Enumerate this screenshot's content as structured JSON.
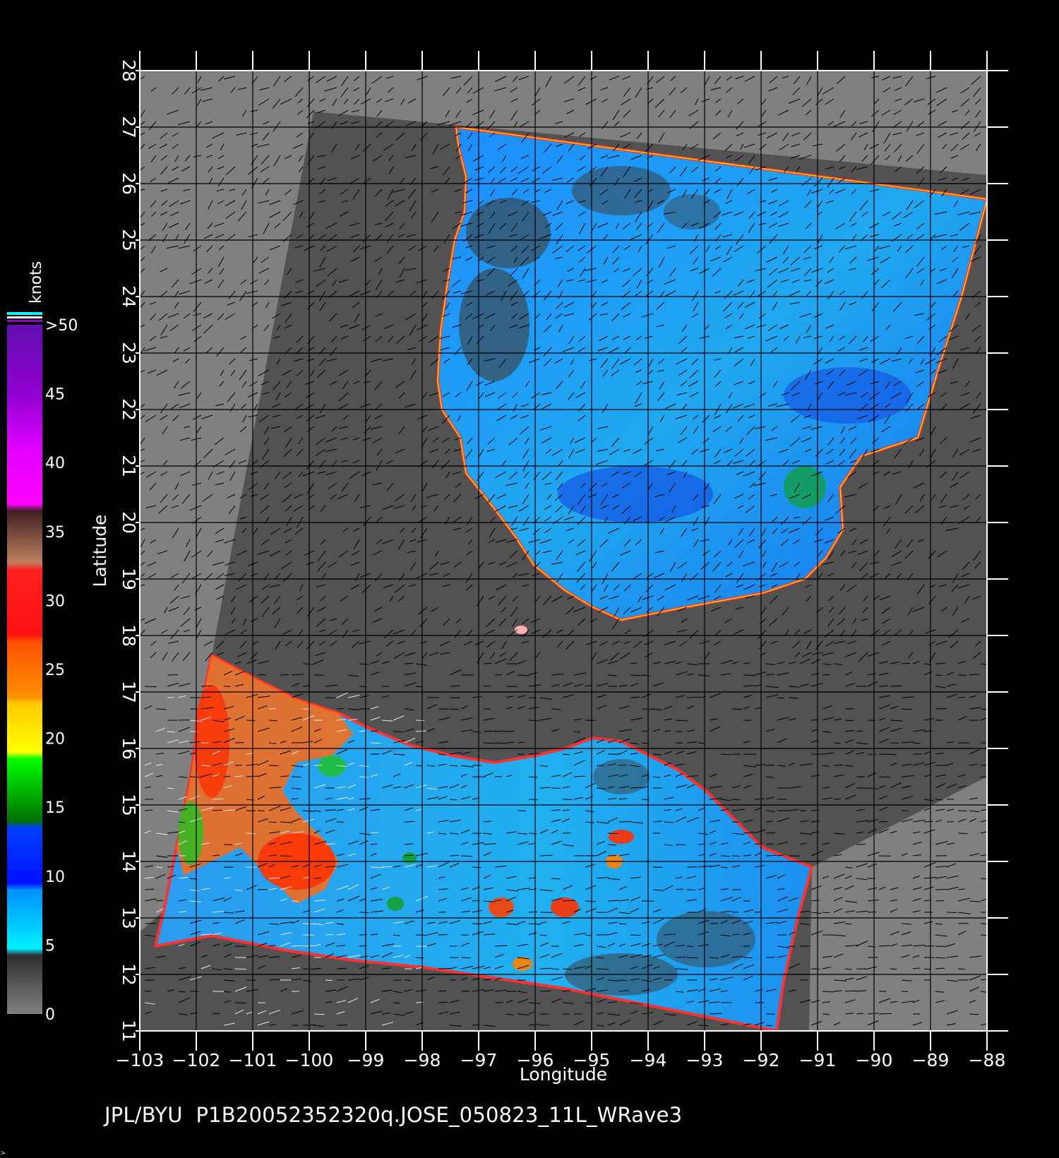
{
  "map": {
    "xlabel": "Longitude",
    "ylabel": "Latitude",
    "lon_range": [
      -103,
      -88
    ],
    "lat_range": [
      11,
      28
    ],
    "lon_ticks": [
      "−103",
      "−102",
      "−101",
      "−100",
      "−99",
      "−98",
      "−97",
      "−96",
      "−95",
      "−94",
      "−93",
      "−92",
      "−91",
      "−90",
      "−89",
      "−88"
    ],
    "lat_ticks": [
      "11",
      "12",
      "13",
      "14",
      "15",
      "16",
      "17",
      "18",
      "19",
      "20",
      "21",
      "22",
      "23",
      "24",
      "25",
      "26",
      "27",
      "28"
    ],
    "grid": true,
    "background_color": "#808080",
    "swath_color": "#505050"
  },
  "colorbar": {
    "unit": "knots",
    "labels": [
      "0",
      "5",
      "10",
      "15",
      "20",
      "25",
      "30",
      "35",
      "40",
      "45",
      ">50"
    ],
    "colors": [
      "#202020",
      "#00e5ff",
      "#0033ff",
      "#00aa00",
      "#ffee00",
      "#ff7700",
      "#ff2200",
      "#b06030",
      "#ff00ff",
      "#aa00cc",
      "#6600aa"
    ]
  },
  "footer": {
    "text": "JPL/BYU  P1B20052352320q.JOSE_050823_11L_WRave3"
  },
  "corner_mark": ">"
}
